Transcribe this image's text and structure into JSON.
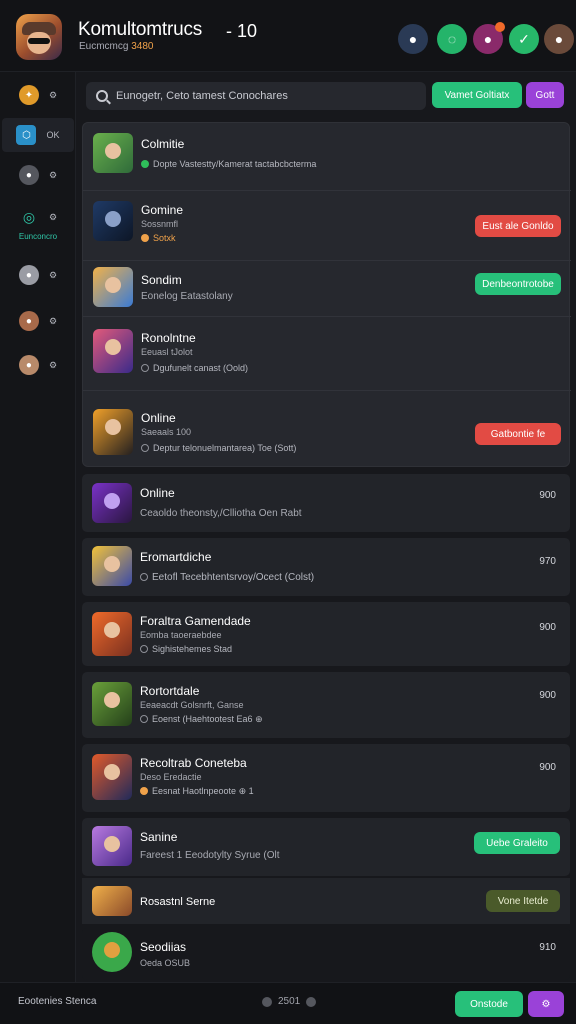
{
  "header": {
    "title": "Komultomtrucs",
    "subtitle": "Eucmcmcg",
    "subtitle_highlight": "3480",
    "count": "- 10",
    "icons": [
      "avatar-blue-icon",
      "chat-green-icon",
      "avatar-magenta-icon",
      "check-green-icon",
      "avatar-brown-icon"
    ]
  },
  "sidebar": {
    "items": [
      {
        "label": "⚙",
        "icon": "gear-icon"
      },
      {
        "label": "OK",
        "icon": "hexagon-icon"
      },
      {
        "label": "⚙",
        "icon": "gear-icon"
      },
      {
        "label": "⚙",
        "icon": "steam-icon"
      },
      {
        "label": "⚙",
        "icon": "avatar-icon"
      },
      {
        "label": "⚙",
        "icon": "avatar-icon"
      },
      {
        "label": "⚙",
        "icon": "avatar-icon"
      }
    ],
    "teal_label": "Eunconcro"
  },
  "search": {
    "placeholder": "Eunogetr, Ceto tamest Conochares"
  },
  "toolbar": {
    "primary": "Vamet Goltiatx",
    "secondary": "Gott"
  },
  "group_items": [
    {
      "name": "Colmitie",
      "sub": "",
      "meta": "Dopte Vastestty/Kamerat tactabcbcterma",
      "price": "",
      "action": "",
      "icon": "g"
    },
    {
      "name": "Gomine",
      "sub": "Sossnmfl",
      "meta": "Sotxk",
      "price": "",
      "action": "Eust ale Gonldo",
      "icon": "o"
    },
    {
      "name": "Sondim",
      "sub": "Eonelog Eatastolany",
      "meta": "",
      "price": "",
      "action": "Denbeontrotobe",
      "icon": ""
    },
    {
      "name": "Ronolntne",
      "sub": "Eeuasl tJolot",
      "meta": "Dgufunelt canast (Oold)",
      "price": "",
      "action": "",
      "icon": "n"
    },
    {
      "name": "Online",
      "sub": "Saeaals 100",
      "meta": "Deptur telonuelmantarea) Toe (Sott)",
      "price": "",
      "action": "Gatbontie fe",
      "icon": "n"
    }
  ],
  "cards": [
    {
      "name": "Online",
      "sub": "Ceaoldo theonsty,/Clliotha Oen Rabt",
      "price": "900"
    },
    {
      "name": "Eromartdiche",
      "sub": "Eetofl Tecebhtentsrvoy/Ocect (Colst)",
      "price": "970"
    },
    {
      "name": "Foraltra Gamendade",
      "sub": "Eomba taoeraebdee",
      "meta": "Sighistehemes Stad",
      "price": "900"
    },
    {
      "name": "Rortortdale",
      "sub": "Eeaeacdt Golsnrft, Ganse",
      "meta": "Eoenst (Haehtootest Ea6 ⊕",
      "price": "900"
    },
    {
      "name": "Recoltrab Coneteba",
      "sub": "Deso Eredactie",
      "meta": "Eesnat Haotlnpeoote ⊕ 1",
      "price": "900"
    },
    {
      "name": "Sanine",
      "sub": "Fareest 1 Eeodotylty Syrue (Olt",
      "action": "Uebe Graleito"
    },
    {
      "name": "Rosastnl Serne",
      "action": "Vone Itetde"
    },
    {
      "name": "Seodiias",
      "sub": "Oeda OSUB",
      "price": "910"
    }
  ],
  "footer": {
    "left": "Eootenies Stenca",
    "page": "2501",
    "primary": "Onstode"
  }
}
